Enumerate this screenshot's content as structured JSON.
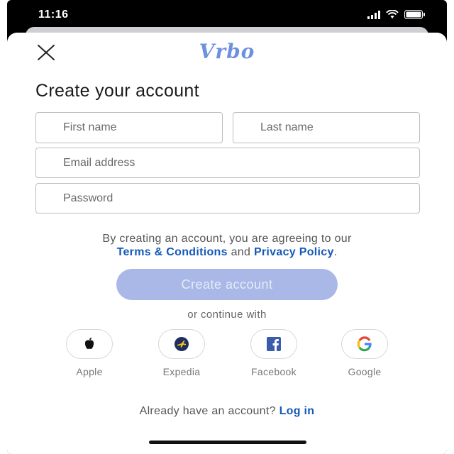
{
  "status": {
    "time": "11:16"
  },
  "header": {
    "logo_text": "Vrbo",
    "close_icon": "close-icon"
  },
  "title": "Create your account",
  "form": {
    "first_name_placeholder": "First name",
    "last_name_placeholder": "Last name",
    "email_placeholder": "Email address",
    "password_placeholder": "Password"
  },
  "terms": {
    "prefix": "By creating an account, you are agreeing to our",
    "terms_link": "Terms & Conditions",
    "and": "and",
    "privacy_link": "Privacy Policy",
    "suffix": "."
  },
  "create_button": "Create account",
  "continue_text": "or continue with",
  "social": [
    {
      "label": "Apple",
      "icon": "apple-icon"
    },
    {
      "label": "Expedia",
      "icon": "expedia-icon"
    },
    {
      "label": "Facebook",
      "icon": "facebook-icon"
    },
    {
      "label": "Google",
      "icon": "google-icon"
    }
  ],
  "login": {
    "prompt": "Already have an account?",
    "link": "Log in"
  },
  "colors": {
    "link": "#1559b8",
    "button_disabled": "#a9b8e6",
    "logo": "#6f8fe0"
  }
}
